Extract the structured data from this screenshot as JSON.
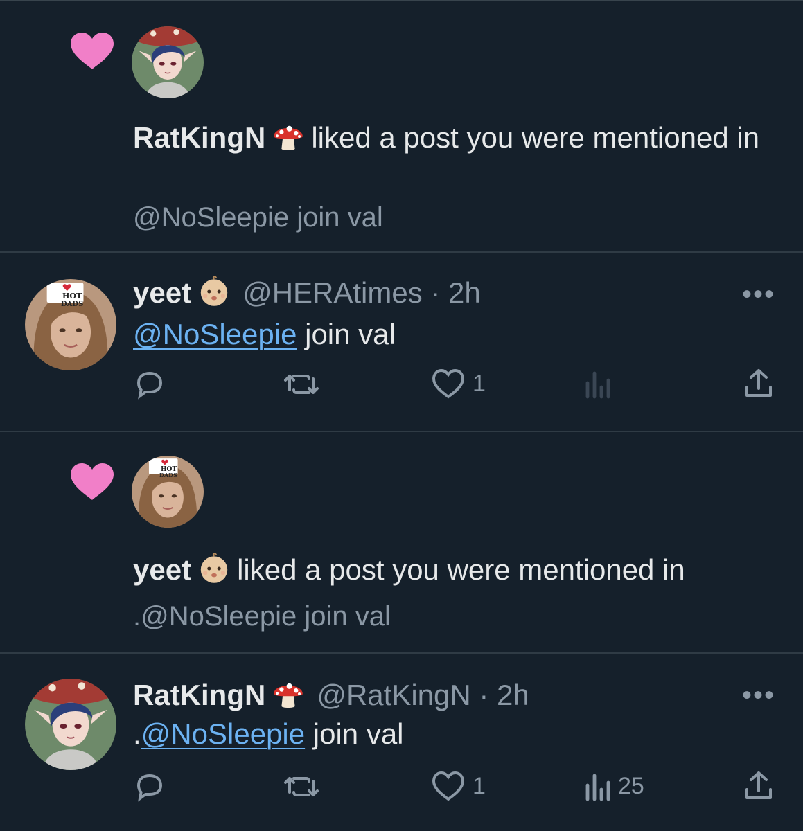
{
  "notifications": [
    {
      "actor_name": "RatKingN",
      "actor_emoji": "mushroom",
      "action_text": "liked a post you were mentioned in",
      "post_preview": "@NoSleepie join val"
    },
    {
      "actor_name": "yeet",
      "actor_emoji": "baby",
      "action_text": "liked a post you were mentioned in",
      "post_preview": ".@NoSleepie join val"
    }
  ],
  "posts": [
    {
      "display_name": "yeet",
      "name_emoji": "baby",
      "handle": "@HERAtimes",
      "time": "· 2h",
      "prefix": "",
      "mention": "@NoSleepie",
      "text": " join val",
      "likes": "1",
      "views": ""
    },
    {
      "display_name": "RatKingN",
      "name_emoji": "mushroom",
      "handle": "@RatKingN",
      "time": "· 2h",
      "prefix": ".",
      "mention": "@NoSleepie",
      "text": " join val",
      "likes": "1",
      "views": "25"
    }
  ],
  "colors": {
    "background": "#15202b",
    "heart": "#f17fc8",
    "link": "#6cb2f2",
    "muted": "#8b98a5"
  },
  "avatar_texts": {
    "badge_line1": "I",
    "badge_line2": "HOT",
    "badge_line3": "DADS"
  }
}
